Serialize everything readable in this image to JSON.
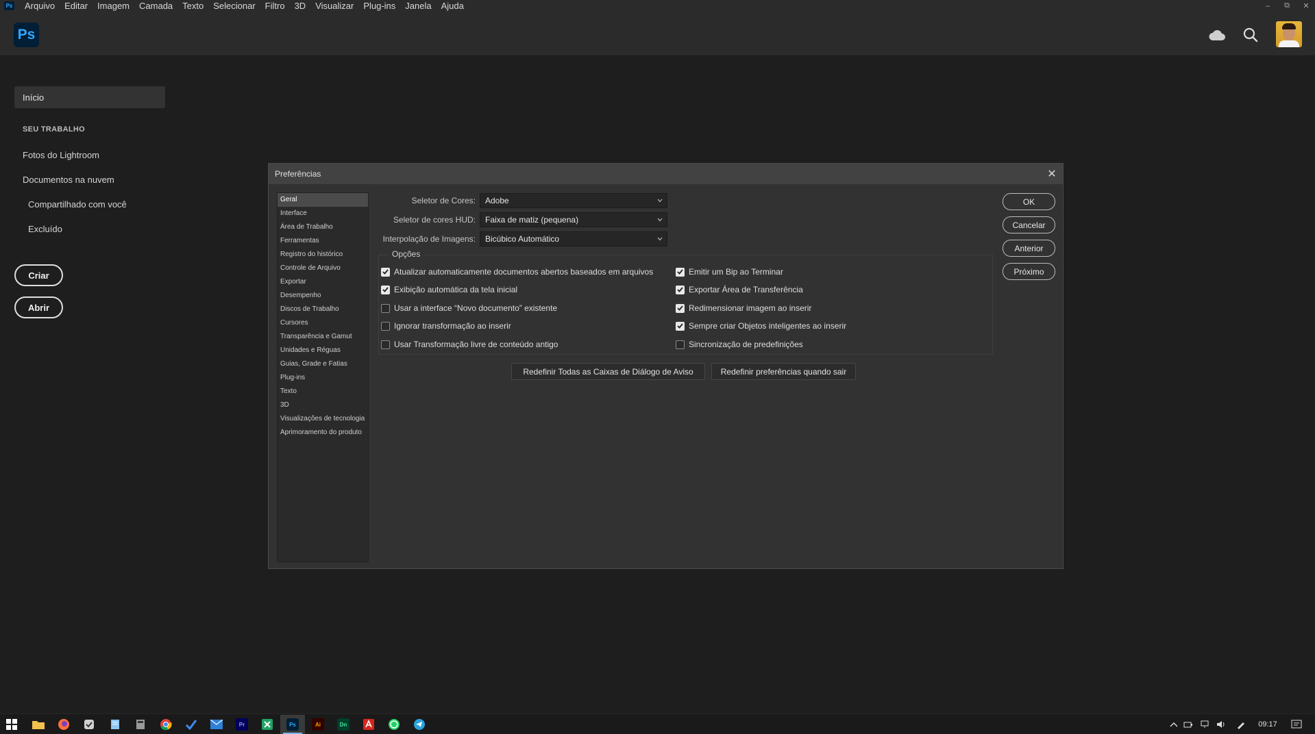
{
  "menubar": {
    "app_badge": "Ps",
    "items": [
      "Arquivo",
      "Editar",
      "Imagem",
      "Camada",
      "Texto",
      "Selecionar",
      "Filtro",
      "3D",
      "Visualizar",
      "Plug-ins",
      "Janela",
      "Ajuda"
    ],
    "window_controls": {
      "minimize": "–",
      "restore": "⧉",
      "close": "✕"
    }
  },
  "header": {
    "logo_text": "Ps",
    "icons": [
      "cloud-icon",
      "search-icon",
      "avatar"
    ]
  },
  "sidebar": {
    "home_label": "Início",
    "section_heading": "SEU TRABALHO",
    "items": [
      "Fotos do Lightroom",
      "Documentos na nuvem",
      "Compartilhado com você",
      "Excluído"
    ],
    "create_button": "Criar",
    "open_button": "Abrir"
  },
  "dialog": {
    "title": "Preferências",
    "close_glyph": "✕",
    "categories": [
      "Geral",
      "Interface",
      "Área de Trabalho",
      "Ferramentas",
      "Registro do histórico",
      "Controle de Arquivo",
      "Exportar",
      "Desempenho",
      "Discos de Trabalho",
      "Cursores",
      "Transparência e Gamut",
      "Unidades e Réguas",
      "Guias, Grade e Fatias",
      "Plug-ins",
      "Texto",
      "3D",
      "Visualizações de tecnologia",
      "Aprimoramento do produto"
    ],
    "selected_category": "Geral",
    "fields": [
      {
        "label": "Seletor de Cores:",
        "value": "Adobe"
      },
      {
        "label": "Seletor de cores HUD:",
        "value": "Faixa de matiz (pequena)"
      },
      {
        "label": "Interpolação de Imagens:",
        "value": "Bicúbico Automático"
      }
    ],
    "options_legend": "Opções",
    "options_left": [
      {
        "label": "Atualizar automaticamente documentos abertos baseados em arquivos",
        "checked": true
      },
      {
        "label": "Exibição automática da tela inicial",
        "checked": true
      },
      {
        "label": "Usar a interface “Novo documento” existente",
        "checked": false
      },
      {
        "label": "Ignorar transformação ao inserir",
        "checked": false
      },
      {
        "label": "Usar Transformação livre de conteúdo antigo",
        "checked": false
      }
    ],
    "options_right": [
      {
        "label": "Emitir um Bip ao Terminar",
        "checked": true
      },
      {
        "label": "Exportar Área de Transferência",
        "checked": true
      },
      {
        "label": "Redimensionar imagem ao inserir",
        "checked": true
      },
      {
        "label": "Sempre criar Objetos inteligentes ao inserir",
        "checked": true
      },
      {
        "label": "Sincronização de predefinições",
        "checked": false
      }
    ],
    "reset_dialogs_button": "Redefinir Todas as Caixas de Diálogo de Aviso",
    "reset_prefs_button": "Redefinir preferências quando sair",
    "buttons": {
      "ok": "OK",
      "cancel": "Cancelar",
      "previous": "Anterior",
      "next": "Próximo"
    }
  },
  "taskbar": {
    "apps": [
      "start-icon",
      "file-explorer-icon",
      "firefox-icon",
      "app-icon",
      "notepad-icon",
      "calculator-icon",
      "chrome-icon",
      "todo-icon",
      "mail-icon",
      "premiere-icon",
      "spreadsheet-icon",
      "photoshop-icon",
      "illustrator-icon",
      "dimension-icon",
      "acrobat-icon",
      "whatsapp-icon",
      "telegram-icon"
    ],
    "app_labels": {
      "premiere": "Pr",
      "photoshop": "Ps",
      "illustrator": "Ai",
      "dimension": "Dn"
    },
    "clock": "09:17",
    "colors": {
      "ps_blue": "#31a8ff",
      "ps_bg": "#001e36",
      "accent": "#7cb4e8"
    }
  }
}
